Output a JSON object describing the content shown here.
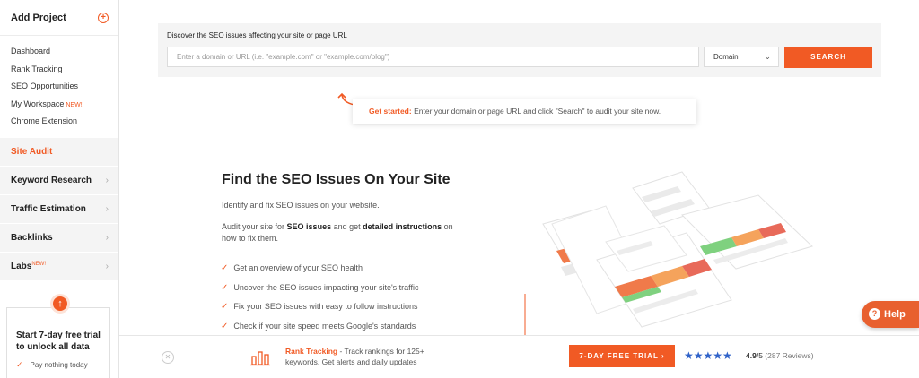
{
  "sidebar": {
    "add_project": "Add Project",
    "links": [
      {
        "label": "Dashboard"
      },
      {
        "label": "Rank Tracking"
      },
      {
        "label": "SEO Opportunities"
      },
      {
        "label": "My Workspace",
        "badge": "NEW!"
      },
      {
        "label": "Chrome Extension"
      }
    ],
    "active_item": "Site Audit",
    "nav_items": [
      {
        "label": "Keyword Research"
      },
      {
        "label": "Traffic Estimation"
      },
      {
        "label": "Backlinks"
      },
      {
        "label": "Labs",
        "badge": "NEW!"
      }
    ],
    "trial": {
      "title": "Start 7-day free trial to unlock all data",
      "check": "Pay nothing today"
    }
  },
  "search": {
    "label": "Discover the SEO issues affecting your site or page URL",
    "placeholder": "Enter a domain or URL (i.e. \"example.com\" or \"example.com/blog\")",
    "select_value": "Domain",
    "button": "SEARCH"
  },
  "get_started": {
    "lead": "Get started:",
    "text": "Enter your domain or page URL and click \"Search\" to audit your site now."
  },
  "hero": {
    "title": "Find the SEO Issues On Your Site",
    "subtitle": "Identify and fix SEO issues on your website.",
    "desc_1": "Audit your site for ",
    "desc_b1": "SEO issues",
    "desc_2": " and get ",
    "desc_b2": "detailed instructions",
    "desc_3": " on how to fix them.",
    "bullets": [
      "Get an overview of your SEO health",
      "Uncover the SEO issues impacting your site's traffic",
      "Fix your SEO issues with easy to follow instructions",
      "Check if your site speed meets Google's standards"
    ]
  },
  "help": {
    "label": "Help"
  },
  "bottom": {
    "rt_title": "Rank Tracking",
    "rt_text": " - Track rankings for 125+ keywords. Get alerts and daily updates",
    "trial_button": "7-DAY FREE TRIAL",
    "trial_arrow": "›",
    "stars": "★★★★★",
    "rating": "4.9",
    "rating_of": "/5",
    "reviews": "(287 Reviews)"
  },
  "colors": {
    "accent": "#f15a24",
    "star": "#2f62c9"
  }
}
